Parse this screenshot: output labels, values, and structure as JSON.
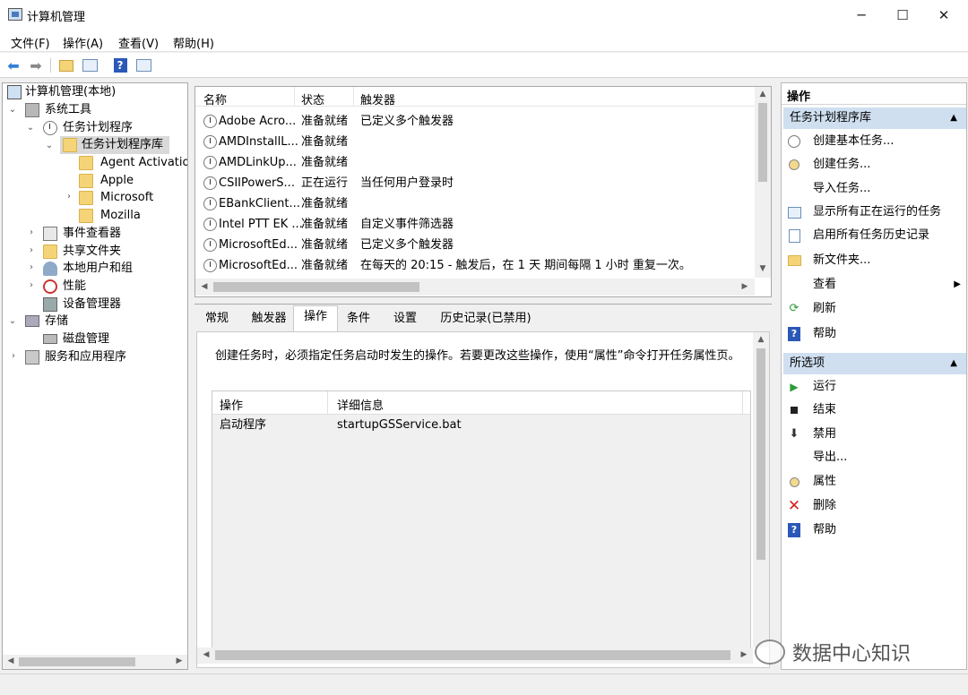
{
  "window": {
    "title": "计算机管理"
  },
  "menu": [
    "文件(F)",
    "操作(A)",
    "查看(V)",
    "帮助(H)"
  ],
  "tree": {
    "root": "计算机管理(本地)",
    "system_tools": "系统工具",
    "task_scheduler": "任务计划程序",
    "task_library": "任务计划程序库",
    "agent": "Agent Activation",
    "apple": "Apple",
    "microsoft": "Microsoft",
    "mozilla": "Mozilla",
    "event_viewer": "事件查看器",
    "shared_folders": "共享文件夹",
    "local_users": "本地用户和组",
    "performance": "性能",
    "device_manager": "设备管理器",
    "storage": "存储",
    "disk_mgmt": "磁盘管理",
    "services_apps": "服务和应用程序"
  },
  "task_list": {
    "headers": [
      "名称",
      "状态",
      "触发器"
    ],
    "rows": [
      {
        "name": "Adobe Acro...",
        "status": "准备就绪",
        "trigger": "已定义多个触发器"
      },
      {
        "name": "AMDInstallL...",
        "status": "准备就绪",
        "trigger": ""
      },
      {
        "name": "AMDLinkUp...",
        "status": "准备就绪",
        "trigger": ""
      },
      {
        "name": "CSIIPowerS...",
        "status": "正在运行",
        "trigger": "当任何用户登录时"
      },
      {
        "name": "EBankClient...",
        "status": "准备就绪",
        "trigger": ""
      },
      {
        "name": "Intel PTT EK ...",
        "status": "准备就绪",
        "trigger": "自定义事件筛选器"
      },
      {
        "name": "MicrosoftEd...",
        "status": "准备就绪",
        "trigger": "已定义多个触发器"
      },
      {
        "name": "MicrosoftEd...",
        "status": "准备就绪",
        "trigger": "在每天的 20:15 - 触发后，在 1 天 期间每隔 1 小时 重复一次。"
      }
    ]
  },
  "tabs": [
    "常规",
    "触发器",
    "操作",
    "条件",
    "设置",
    "历史记录(已禁用)"
  ],
  "detail": {
    "description": "创建任务时，必须指定任务启动时发生的操作。若要更改这些操作，使用“属性”命令打开任务属性页。",
    "headers": [
      "操作",
      "详细信息"
    ],
    "rows": [
      {
        "action": "启动程序",
        "detail": "startupGSService.bat"
      }
    ]
  },
  "actions": {
    "title": "操作",
    "section1": "任务计划程序库",
    "items1": [
      "创建基本任务...",
      "创建任务...",
      "导入任务...",
      "显示所有正在运行的任务",
      "启用所有任务历史记录",
      "新文件夹...",
      "查看",
      "刷新",
      "帮助"
    ],
    "section2": "所选项",
    "items2": [
      "运行",
      "结束",
      "禁用",
      "导出...",
      "属性",
      "删除",
      "帮助"
    ]
  },
  "watermark": "数据中心知识"
}
